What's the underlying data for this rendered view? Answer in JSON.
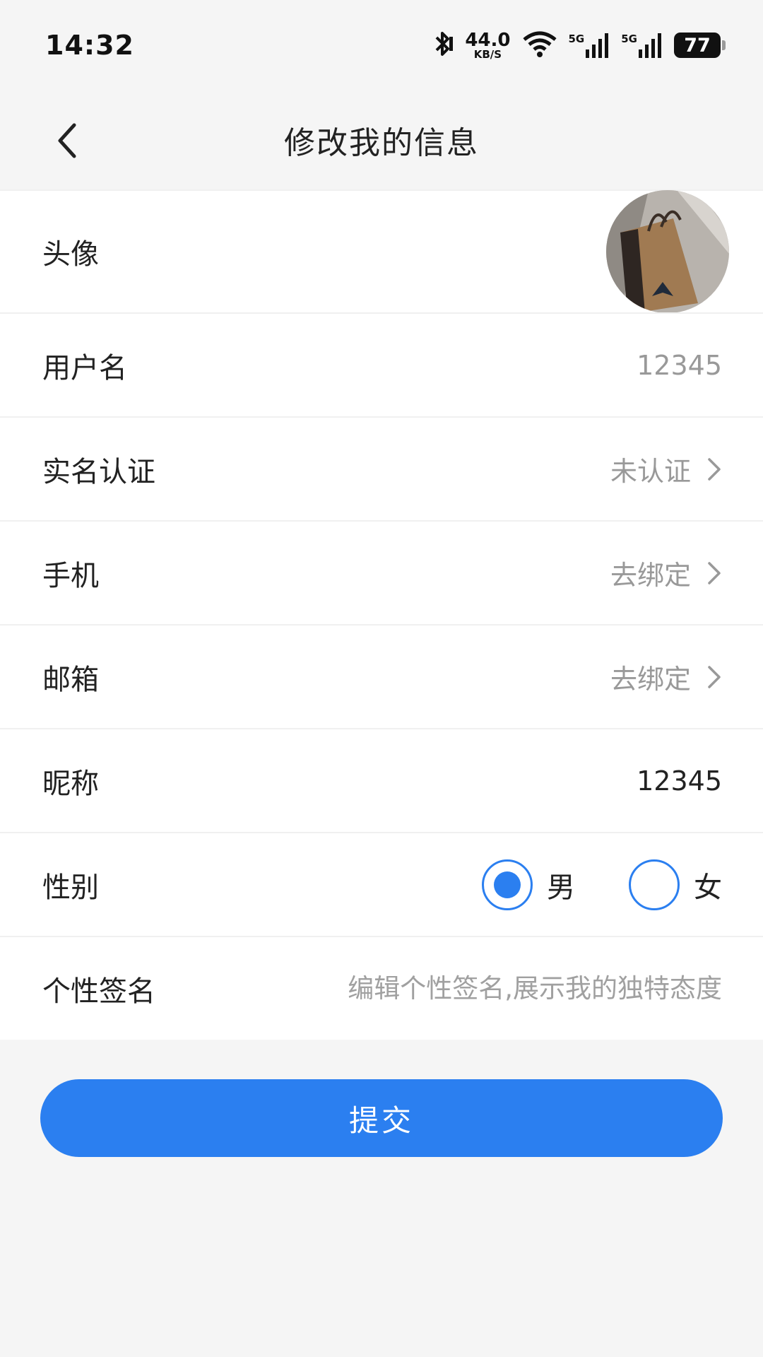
{
  "status_bar": {
    "time": "14:32",
    "network_speed": "44.0",
    "speed_unit": "KB/S",
    "signal_1_label": "5G",
    "signal_2_label": "5G",
    "battery": "77"
  },
  "header": {
    "title": "修改我的信息"
  },
  "form": {
    "avatar": {
      "label": "头像"
    },
    "username": {
      "label": "用户名",
      "value": "12345"
    },
    "real_name": {
      "label": "实名认证",
      "value": "未认证"
    },
    "phone": {
      "label": "手机",
      "value": "去绑定"
    },
    "email": {
      "label": "邮箱",
      "value": "去绑定"
    },
    "nickname": {
      "label": "昵称",
      "value": "12345"
    },
    "gender": {
      "label": "性别",
      "options": [
        "男",
        "女"
      ],
      "selected": "男"
    },
    "signature": {
      "label": "个性签名",
      "placeholder": "编辑个性签名,展示我的独特态度",
      "value": ""
    }
  },
  "submit_label": "提交",
  "colors": {
    "accent": "#2b7ff0",
    "secondary_text": "#999999",
    "background": "#f5f5f5"
  }
}
